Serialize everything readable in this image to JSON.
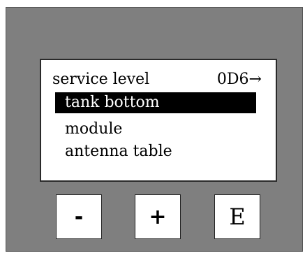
{
  "display": {
    "header": {
      "label": "service level",
      "code": "0D6→"
    },
    "menu": [
      {
        "label": "tank bottom",
        "selected": true
      },
      {
        "label": "module",
        "selected": false
      },
      {
        "label": "antenna table",
        "selected": false
      }
    ]
  },
  "keys": {
    "minus": "-",
    "plus": "+",
    "enter": "E"
  },
  "colors": {
    "panel": "#7f7f7f",
    "display_bg": "#ffffff",
    "selection_bg": "#000000",
    "selection_text": "#ffffff"
  }
}
